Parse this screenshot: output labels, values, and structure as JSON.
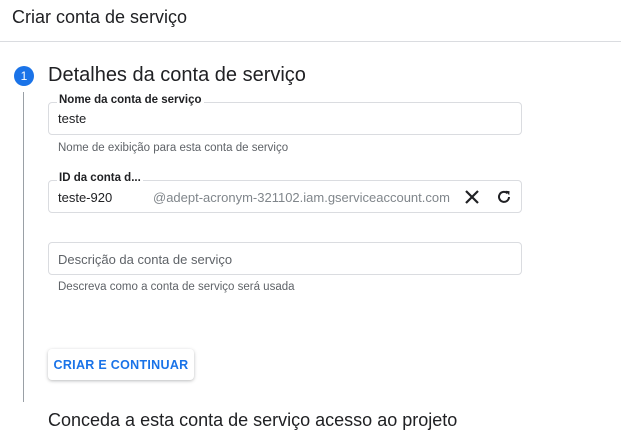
{
  "header": {
    "title": "Criar conta de serviço"
  },
  "step": {
    "number": "1",
    "title": "Detalhes da conta de serviço",
    "color": "#1a73e8"
  },
  "fields": {
    "name": {
      "label": "Nome da conta de serviço",
      "value": "teste",
      "hint": "Nome de exibição para esta conta de serviço"
    },
    "id": {
      "label": "ID da conta d...",
      "value": "teste-920",
      "suffix": "@adept-acronym-321102.iam.gserviceaccount.com",
      "icons": [
        "close-icon",
        "refresh-icon"
      ]
    },
    "description": {
      "placeholder": "Descrição da conta de serviço",
      "hint": "Descreva como a conta de serviço será usada"
    }
  },
  "actions": {
    "create_label": "CRIAR E CONTINUAR"
  },
  "next_step": {
    "title": "Conceda a esta conta de serviço acesso ao projeto"
  }
}
